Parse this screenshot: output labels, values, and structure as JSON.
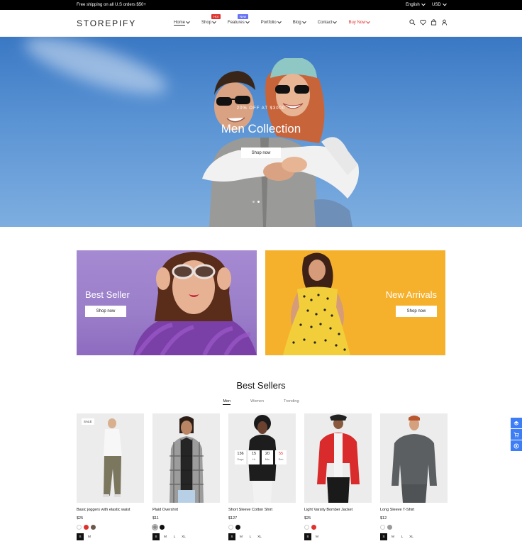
{
  "topbar": {
    "promo": "Free shipping on all U.S orders $50+",
    "language": "English",
    "currency": "USD"
  },
  "header": {
    "logo": "STOREPIFY",
    "nav": [
      {
        "label": "Home"
      },
      {
        "label": "Shop",
        "badge": "Hot"
      },
      {
        "label": "Features",
        "badge": "New"
      },
      {
        "label": "Portfolio"
      },
      {
        "label": "Blog"
      },
      {
        "label": "Contact"
      },
      {
        "label": "Buy Now"
      }
    ],
    "icons": [
      "search-icon",
      "heart-icon",
      "bag-icon",
      "user-icon"
    ]
  },
  "hero": {
    "subtitle": "20% OFF AT $3000",
    "title": "Men Collection",
    "button": "Shop now",
    "slides": 2,
    "active_slide": 2
  },
  "banners": [
    {
      "title": "Best Seller",
      "button": "Shop now",
      "color": "#9a7ec9"
    },
    {
      "title": "New Arrivals",
      "button": "Shop now",
      "color": "#f6b12c"
    }
  ],
  "best_sellers": {
    "title": "Best Sellers",
    "tabs": [
      "Men",
      "Women",
      "Trending"
    ],
    "active_tab": "Men",
    "products": [
      {
        "name": "Basic joggers with elastic waist",
        "price": "$25",
        "badge": "SALE",
        "colors": [
          "#ffffff",
          "#e0322d",
          "#6b5a4b"
        ],
        "sizes": [
          "S",
          "M"
        ]
      },
      {
        "name": "Plaid Overshirt",
        "price": "$11",
        "colors": [
          "#8a8a8a",
          "#111111"
        ],
        "sizes": [
          "S",
          "M",
          "L",
          "XL"
        ]
      },
      {
        "name": "Short Sleeve Cotton Shirt",
        "price": "$127",
        "colors": [
          "#ffffff",
          "#111111"
        ],
        "sizes": [
          "S",
          "M",
          "L",
          "XL"
        ],
        "countdown": [
          {
            "value": "136",
            "unit": "Days"
          },
          {
            "value": "15",
            "unit": "Hr"
          },
          {
            "value": "20",
            "unit": "Min"
          },
          {
            "value": "55",
            "unit": "Sec"
          }
        ]
      },
      {
        "name": "Light Varsity Bomber Jacket",
        "price": "$25",
        "colors": [
          "#ffffff",
          "#e0322d"
        ],
        "sizes": [
          "S",
          "M"
        ]
      },
      {
        "name": "Long Sleeve T-Shirt",
        "price": "$12",
        "colors": [
          "#ffffff",
          "#999999"
        ],
        "sizes": [
          "S",
          "M",
          "L",
          "XL"
        ]
      }
    ]
  },
  "side_widget": [
    "layers-icon",
    "cart-icon",
    "support-icon"
  ]
}
